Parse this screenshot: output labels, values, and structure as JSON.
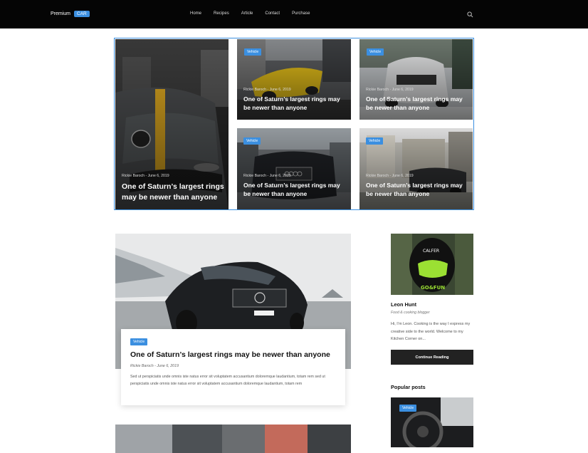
{
  "header": {
    "logo_text": "Premium",
    "logo_accent": "CAR",
    "nav": [
      "Home",
      "Recipes",
      "Article",
      "Contact",
      "Purchase"
    ],
    "search_icon": "search-icon"
  },
  "hero": {
    "tiles": [
      {
        "tag": "Vehicle",
        "meta": "Rickie Baroch - June 6, 2019",
        "title": "One of Saturn’s largest rings may be newer than anyone"
      },
      {
        "tag": "Vehicle",
        "meta": "Rickie Baroch - June 6, 2019",
        "title": "One of Saturn’s largest rings may be newer than anyone"
      },
      {
        "tag": "Vehicle",
        "meta": "Rickie Baroch - June 6, 2019",
        "title": "One of Saturn’s largest rings may be newer than anyone"
      },
      {
        "tag": "Vehicle",
        "meta": "Rickie Baroch - June 6, 2019",
        "title": "One of Saturn’s largest rings may be newer than anyone"
      },
      {
        "tag": "Vehicle",
        "meta": "Rickie Baroch - June 6, 2019",
        "title": "One of Saturn’s largest rings may be newer than anyone"
      }
    ]
  },
  "featured": {
    "tag": "Vehicle",
    "title": "One of Saturn’s largest rings may be newer than anyone",
    "meta": "Rickie Baroch - June 6, 2019",
    "excerpt": "Sed ut perspiciatis unde omnis iste natus error sit voluptatem accusantium doloremque laudantium, totam rem sed ut perspiciatis unde omnis iste natus error sit voluptatem accusantium doloremque laudantium, totam rem"
  },
  "sidebar": {
    "author_name": "Leon Hunt",
    "author_role": "Food & cooking blogger",
    "author_bio": "Hi, I’m Leon. Cooking is the way I express my creative side to the world. Welcome to my Kitchen Corner on...",
    "button_label": "Continue Reading",
    "helmet_text": "CALFER",
    "visor_text": "GO&FUN",
    "popular_title": "Popular posts",
    "popular_tag": "Vehicle"
  },
  "colors": {
    "accent": "#3b8fe0",
    "header_bg": "#050505",
    "button_bg": "#222222"
  }
}
